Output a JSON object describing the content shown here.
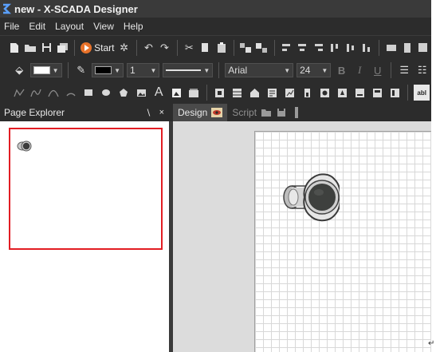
{
  "window": {
    "title": "new - X-SCADA Designer"
  },
  "menubar": {
    "items": [
      "File",
      "Edit",
      "Layout",
      "View",
      "Help"
    ]
  },
  "toolbar1": {
    "start_label": "Start"
  },
  "toolbar2": {
    "fill_color": "#ffffff",
    "line_color": "#000000",
    "line_width": "1",
    "font_name": "Arial",
    "font_size": "24",
    "bold": "B",
    "italic": "I",
    "underline": "U",
    "abl": "abl"
  },
  "toolbar3": {
    "text_tool": "A"
  },
  "page_explorer": {
    "title": "Page Explorer",
    "pin": "∖",
    "close": "×"
  },
  "tabs": {
    "design": "Design",
    "script": "Script"
  },
  "colors": {
    "selection_border": "#e21d23",
    "chrome": "#2c2c2c",
    "grid": "#d8d8d8"
  },
  "symbols": {
    "speaker": "speaker-symbol"
  }
}
